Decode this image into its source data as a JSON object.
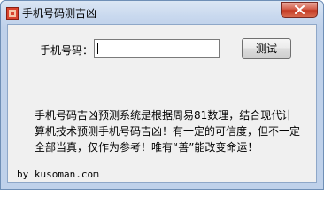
{
  "window": {
    "title": "手机号码测吉凶",
    "icon": "app-icon",
    "close_icon": "close-icon",
    "accent_color": "#c43b24"
  },
  "form": {
    "phone_label": "手机号码：",
    "phone_value": "",
    "test_button_label": "测试"
  },
  "description": "手机号码吉凶预测系统是根据周易81数理，结合现代计算机技术预测手机号码吉凶！有一定的可信度，但不一定全部当真，仅作为参考！唯有“善”能改变命运！",
  "credit": "by kusoman.com"
}
